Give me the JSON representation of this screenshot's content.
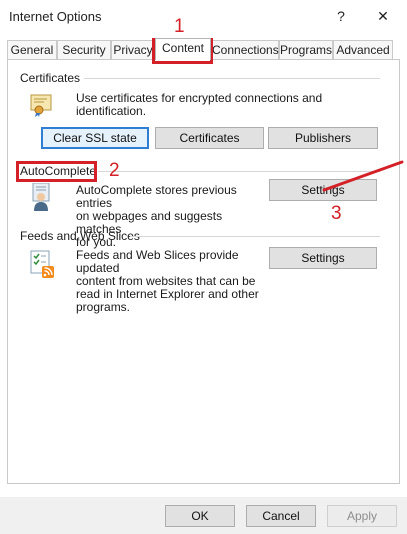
{
  "window": {
    "title": "Internet Options",
    "help_glyph": "?",
    "close_glyph": "✕"
  },
  "tabs": [
    {
      "label": "General"
    },
    {
      "label": "Security"
    },
    {
      "label": "Privacy"
    },
    {
      "label": "Content"
    },
    {
      "label": "Connections"
    },
    {
      "label": "Programs"
    },
    {
      "label": "Advanced"
    }
  ],
  "active_tab": "Content",
  "certificates": {
    "heading": "Certificates",
    "description": "Use certificates for encrypted connections and identification.",
    "buttons": [
      "Clear SSL state",
      "Certificates",
      "Publishers"
    ]
  },
  "autocomplete": {
    "heading": "AutoComplete",
    "description_lines": [
      "AutoComplete stores previous entries",
      "on webpages and suggests matches",
      "for you."
    ],
    "settings_label": "Settings"
  },
  "feeds": {
    "heading": "Feeds and Web Slices",
    "description_lines": [
      "Feeds and Web Slices provide updated",
      "content from websites that can be",
      "read in Internet Explorer and other",
      "programs."
    ],
    "settings_label": "Settings"
  },
  "footer": {
    "ok": "OK",
    "cancel": "Cancel",
    "apply": "Apply"
  },
  "annotations": {
    "n1": "1",
    "n2": "2",
    "n3": "3",
    "color": "#d42027"
  }
}
